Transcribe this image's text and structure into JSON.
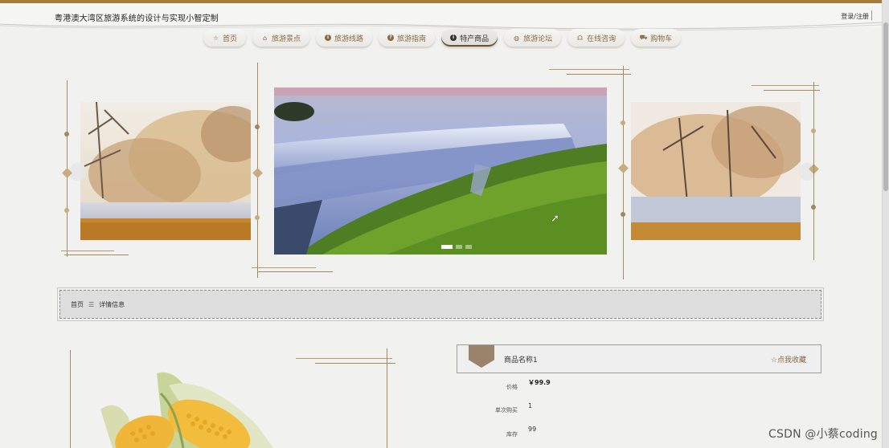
{
  "header": {
    "site_title": "粤港澳大湾区旅游系统的设计与实现小智定制",
    "login_label": "登录/注册"
  },
  "nav": {
    "items": [
      {
        "label": "首页",
        "icon": "star-icon",
        "active": false
      },
      {
        "label": "旅游景点",
        "icon": "home-icon",
        "active": false
      },
      {
        "label": "旅游线路",
        "icon": "info-icon",
        "active": false
      },
      {
        "label": "旅游指南",
        "icon": "question-icon",
        "active": false
      },
      {
        "label": "特产商品",
        "icon": "info-icon",
        "active": true
      },
      {
        "label": "旅游论坛",
        "icon": "globe-icon",
        "active": false
      },
      {
        "label": "在线咨询",
        "icon": "headset-icon",
        "active": false
      },
      {
        "label": "购物车",
        "icon": "cart-icon",
        "active": false
      }
    ]
  },
  "carousel": {
    "active_index": 0,
    "slide_count": 3
  },
  "breadcrumb": {
    "home": "首页",
    "separator": "☰",
    "current": "详情信息"
  },
  "product": {
    "name": "商品名称1",
    "favorite_label": "☆点我收藏",
    "price_label": "价格",
    "price_value": "￥99.9",
    "min_buy_label": "单次购买",
    "min_buy_value": "1",
    "stock_label": "库存",
    "stock_value": "99"
  },
  "watermark": "CSDN @小蔡coding",
  "colors": {
    "accent": "#a77a3e",
    "nav_text": "#8a6a44",
    "crumb_bg": "#dedede"
  }
}
